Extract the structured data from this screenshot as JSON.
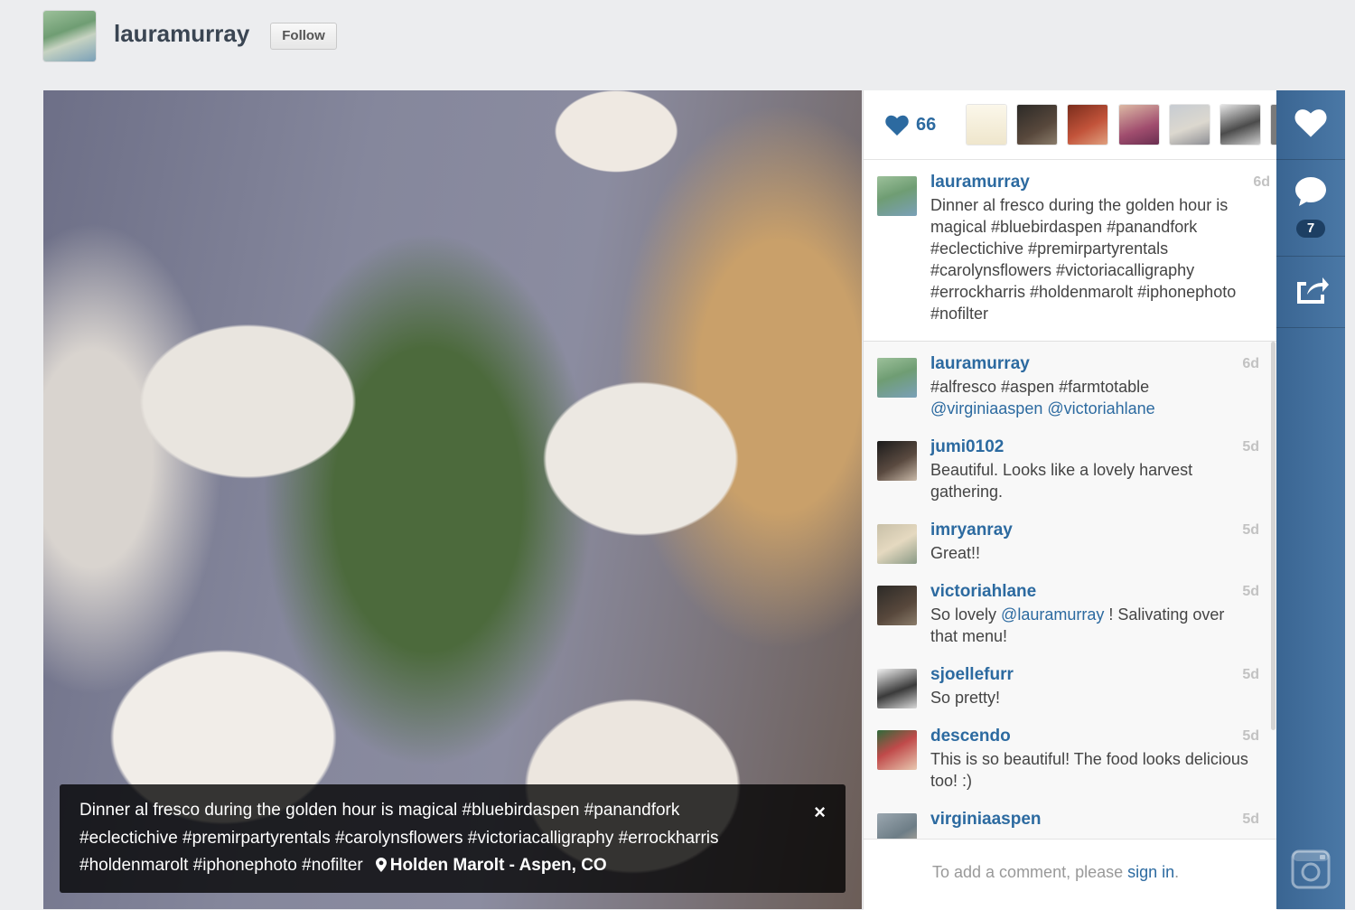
{
  "header": {
    "username": "lauramurray",
    "follow_label": "Follow"
  },
  "photo": {
    "caption": "Dinner al fresco during the golden hour is magical #bluebirdaspen #panandfork #eclectichive #premirpartyrentals #carolynsflowers #victoriacalligraphy #errockharris #holdenmarolt #iphonephoto #nofilter",
    "close_label": "×",
    "location": "Holden Marolt - Aspen, CO"
  },
  "likes": {
    "count": "66",
    "likers": [
      "liker-1",
      "liker-2",
      "liker-3",
      "liker-4",
      "liker-5",
      "liker-6"
    ]
  },
  "caption_entry": {
    "user": "lauramurray",
    "time": "6d",
    "text": "Dinner al fresco during the golden hour is magical #bluebirdaspen #panandfork #eclectichive #premirpartyrentals #carolynsflowers #victoriacalligraphy #errockharris #holdenmarolt #iphonephoto #nofilter"
  },
  "comments": [
    {
      "user": "lauramurray",
      "time": "6d",
      "text": "#alfresco #aspen #farmtotable",
      "mention_line": "@virginiaaspen @victoriahlane"
    },
    {
      "user": "jumi0102",
      "time": "5d",
      "text": "Beautiful. Looks like a lovely harvest gathering."
    },
    {
      "user": "imryanray",
      "time": "5d",
      "text": "Great!!"
    },
    {
      "user": "victoriahlane",
      "time": "5d",
      "text_before": "So lovely ",
      "mention": "@lauramurray",
      "text_after": " ! Salivating over that menu!"
    },
    {
      "user": "sjoellefurr",
      "time": "5d",
      "text": "So pretty!"
    },
    {
      "user": "descendo",
      "time": "5d",
      "text": "This is so beautiful! The food looks delicious too! :)"
    },
    {
      "user": "virginiaaspen",
      "time": "5d",
      "text": ""
    }
  ],
  "comment_input": {
    "prompt": "To add a comment, please ",
    "link": "sign in",
    "suffix": "."
  },
  "rail": {
    "comment_count": "7"
  },
  "colors": {
    "link": "#2c6aa0",
    "rail": "#3a6592"
  }
}
